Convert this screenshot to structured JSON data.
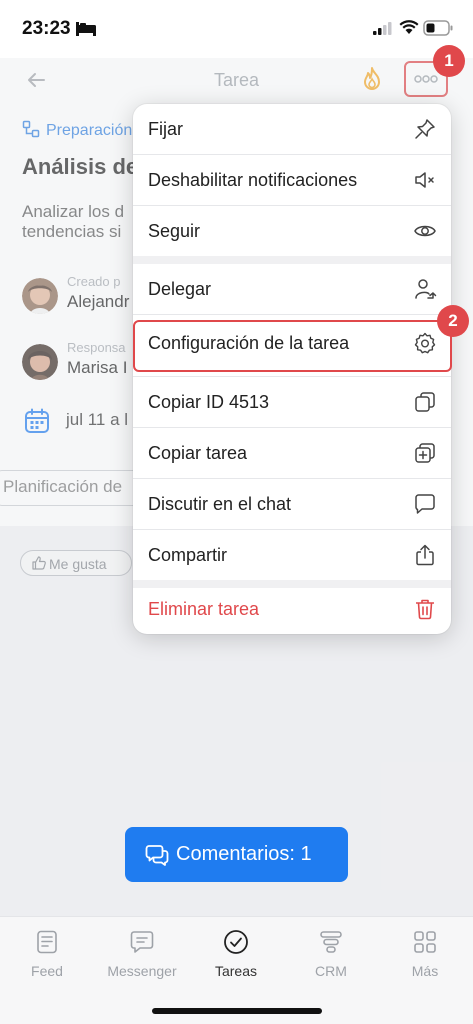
{
  "status_bar": {
    "time": "23:23"
  },
  "header": {
    "title": "Tarea"
  },
  "task": {
    "breadcrumb": "Preparación",
    "title": "Análisis de",
    "description_line1": "Analizar los d",
    "description_line2": "tendencias si",
    "created_by_label": "Creado p",
    "created_by_name": "Alejandr",
    "responsible_label": "Responsa",
    "responsible_name": "Marisa I",
    "date": "jul 11 a l",
    "planning": "Planificación de",
    "like": "Me gusta"
  },
  "menu": {
    "items": [
      {
        "label": "Fijar",
        "icon": "pin-icon"
      },
      {
        "label": "Deshabilitar notificaciones",
        "icon": "mute-icon"
      },
      {
        "label": "Seguir",
        "icon": "eye-icon"
      },
      {
        "label": "Delegar",
        "icon": "delegate-icon"
      },
      {
        "label": "Configuración de la tarea",
        "icon": "gear-icon"
      },
      {
        "label": "Copiar ID 4513",
        "icon": "copy-icon"
      },
      {
        "label": "Copiar tarea",
        "icon": "copy-add-icon"
      },
      {
        "label": "Discutir en el chat",
        "icon": "chat-icon"
      },
      {
        "label": "Compartir",
        "icon": "share-icon"
      },
      {
        "label": "Eliminar tarea",
        "icon": "trash-icon"
      }
    ]
  },
  "annotations": {
    "badge1": "1",
    "badge2": "2"
  },
  "comments_button": "Comentarios: 1",
  "tabbar": {
    "tabs": [
      {
        "label": "Feed",
        "icon": "feed-icon"
      },
      {
        "label": "Messenger",
        "icon": "messenger-icon"
      },
      {
        "label": "Tareas",
        "icon": "tasks-icon"
      },
      {
        "label": "CRM",
        "icon": "crm-icon"
      },
      {
        "label": "Más",
        "icon": "grid-icon"
      }
    ],
    "active": "Tareas"
  },
  "colors": {
    "accent": "#1f7cf0",
    "danger": "#e0484b",
    "flame": "#f5a623"
  }
}
